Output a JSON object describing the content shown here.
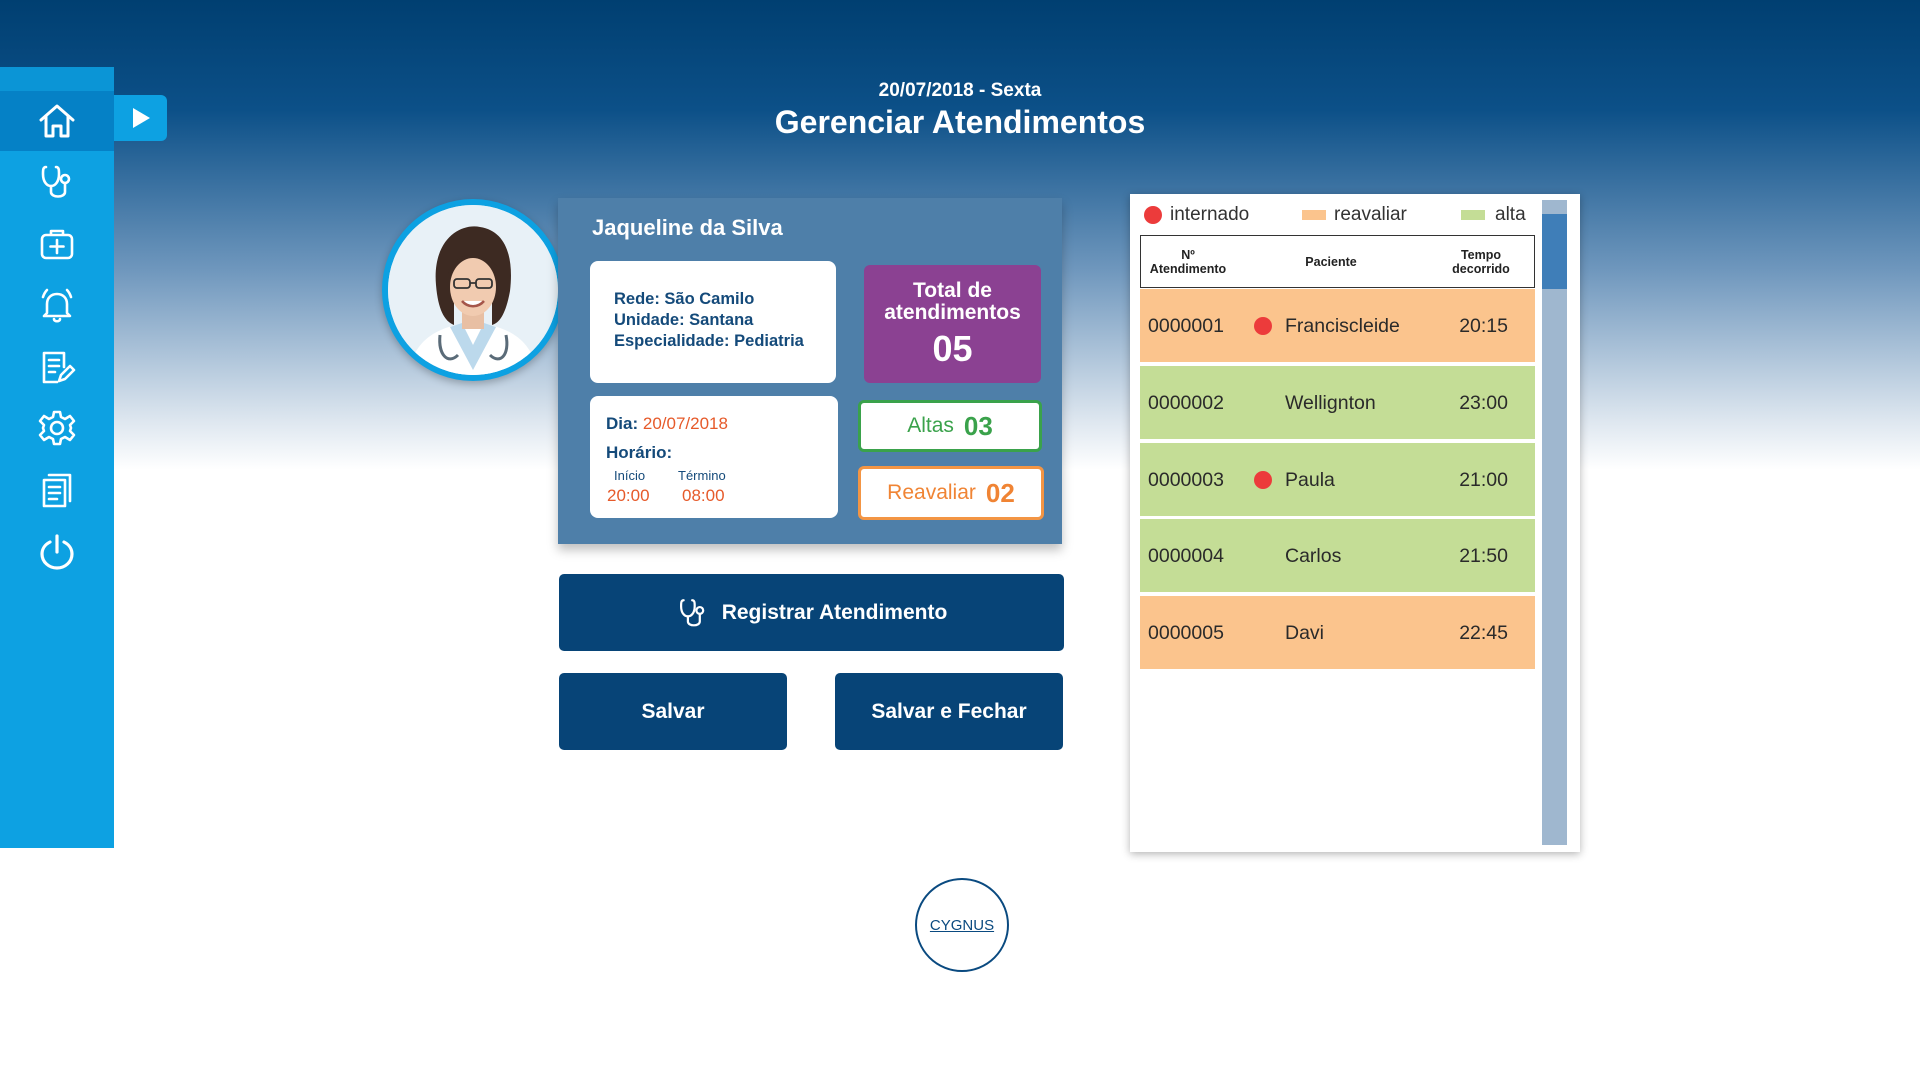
{
  "header": {
    "date": "20/07/2018 - Sexta",
    "title": "Gerenciar Atendimentos"
  },
  "sidebar": {
    "items": [
      {
        "icon": "home-icon",
        "active": true
      },
      {
        "icon": "stethoscope-icon"
      },
      {
        "icon": "medkit-icon"
      },
      {
        "icon": "bell-icon"
      },
      {
        "icon": "edit-note-icon"
      },
      {
        "icon": "gear-icon"
      },
      {
        "icon": "documents-icon"
      },
      {
        "icon": "power-icon"
      }
    ],
    "toggle_icon": "play-icon"
  },
  "doctor": {
    "name": "Jaqueline da Silva",
    "rede": "Rede: São Camilo",
    "unidade": "Unidade: Santana",
    "especialidade": "Especialidade: Pediatria",
    "dia_label": "Dia:",
    "dia_value": "20/07/2018",
    "horario_label": "Horário:",
    "inicio_label": "Início",
    "inicio_value": "20:00",
    "termino_label": "Término",
    "termino_value": "08:00"
  },
  "stats": {
    "total_label_1": "Total de",
    "total_label_2": "atendimentos",
    "total_value": "05",
    "altas_label": "Altas",
    "altas_value": "03",
    "reavaliar_label": "Reavaliar",
    "reavaliar_value": "02"
  },
  "buttons": {
    "registrar": "Registrar Atendimento",
    "salvar": "Salvar",
    "salvar_fechar": "Salvar e Fechar"
  },
  "legend": {
    "internado": "internado",
    "reavaliar": "reavaliar",
    "alta": "alta"
  },
  "colors": {
    "internado": "#ec3b3b",
    "reavaliar": "#fbc48d",
    "alta": "#c4dd96",
    "sidebar": "#0da1e2",
    "button": "#074477",
    "total_box": "#8b4192"
  },
  "table": {
    "headers": {
      "num_line1": "Nº",
      "num_line2": "Atendimento",
      "paciente": "Paciente",
      "tempo_line1": "Tempo",
      "tempo_line2": "decorrido"
    },
    "rows": [
      {
        "num": "0000001",
        "paciente": "Francisclei­de",
        "tempo": "20:15",
        "status": "reavaliar",
        "internado": true
      },
      {
        "num": "0000002",
        "paciente": "Wellignton",
        "tempo": "23:00",
        "status": "alta",
        "internado": false
      },
      {
        "num": "0000003",
        "paciente": "Paula",
        "tempo": "21:00",
        "status": "alta",
        "internado": true
      },
      {
        "num": "0000004",
        "paciente": "Carlos",
        "tempo": "21:50",
        "status": "alta",
        "internado": false
      },
      {
        "num": "0000005",
        "paciente": "Davi",
        "tempo": "22:45",
        "status": "reavaliar",
        "internado": false
      }
    ]
  },
  "logo": {
    "text": "CYGNUS"
  }
}
